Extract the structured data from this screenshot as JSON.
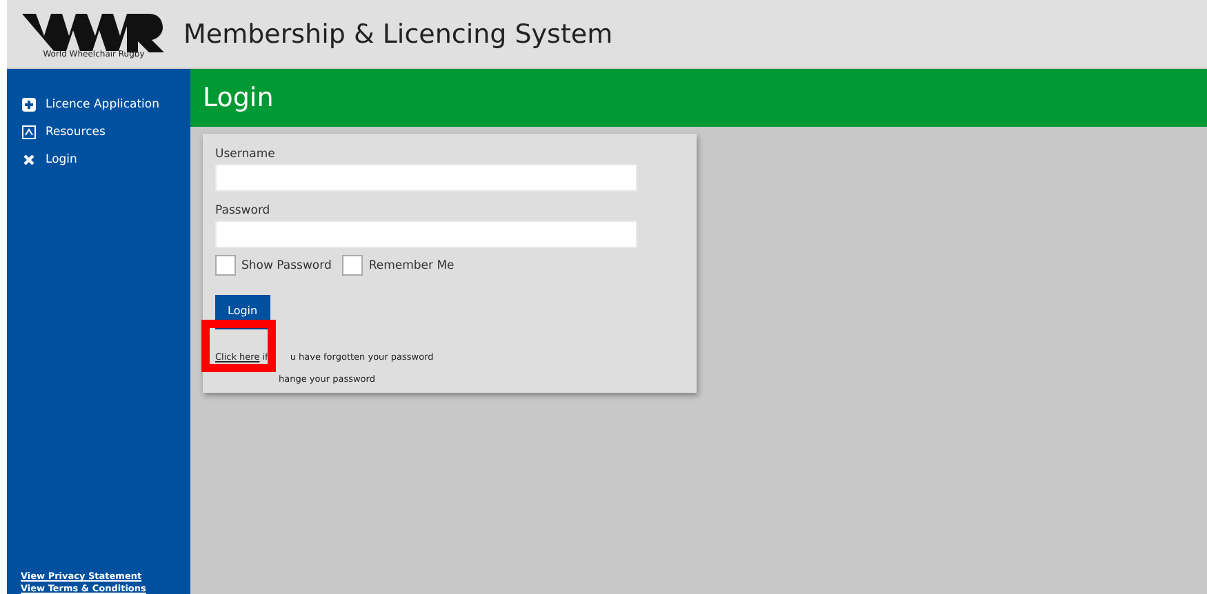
{
  "header": {
    "logo_caption": "World Wheelchair Rugby",
    "title": "Membership & Licencing System"
  },
  "sidebar": {
    "items": [
      {
        "label": "Licence Application"
      },
      {
        "label": "Resources"
      },
      {
        "label": "Login"
      }
    ],
    "footer_links": [
      "View Privacy Statement",
      "View Terms & Conditions"
    ]
  },
  "page_title": "Login",
  "form": {
    "fields": [
      {
        "label": "Username"
      },
      {
        "label": "Password"
      }
    ],
    "options": [
      {
        "label": "Show Password",
        "checked": false
      },
      {
        "label": "Remember Me",
        "checked": false
      }
    ],
    "button": "Login",
    "help_lines": [
      {
        "link": "Click here",
        "parts": [
          "if",
          "u have forgotten your password"
        ]
      },
      {
        "parts": [
          "hange your password"
        ]
      }
    ]
  }
}
